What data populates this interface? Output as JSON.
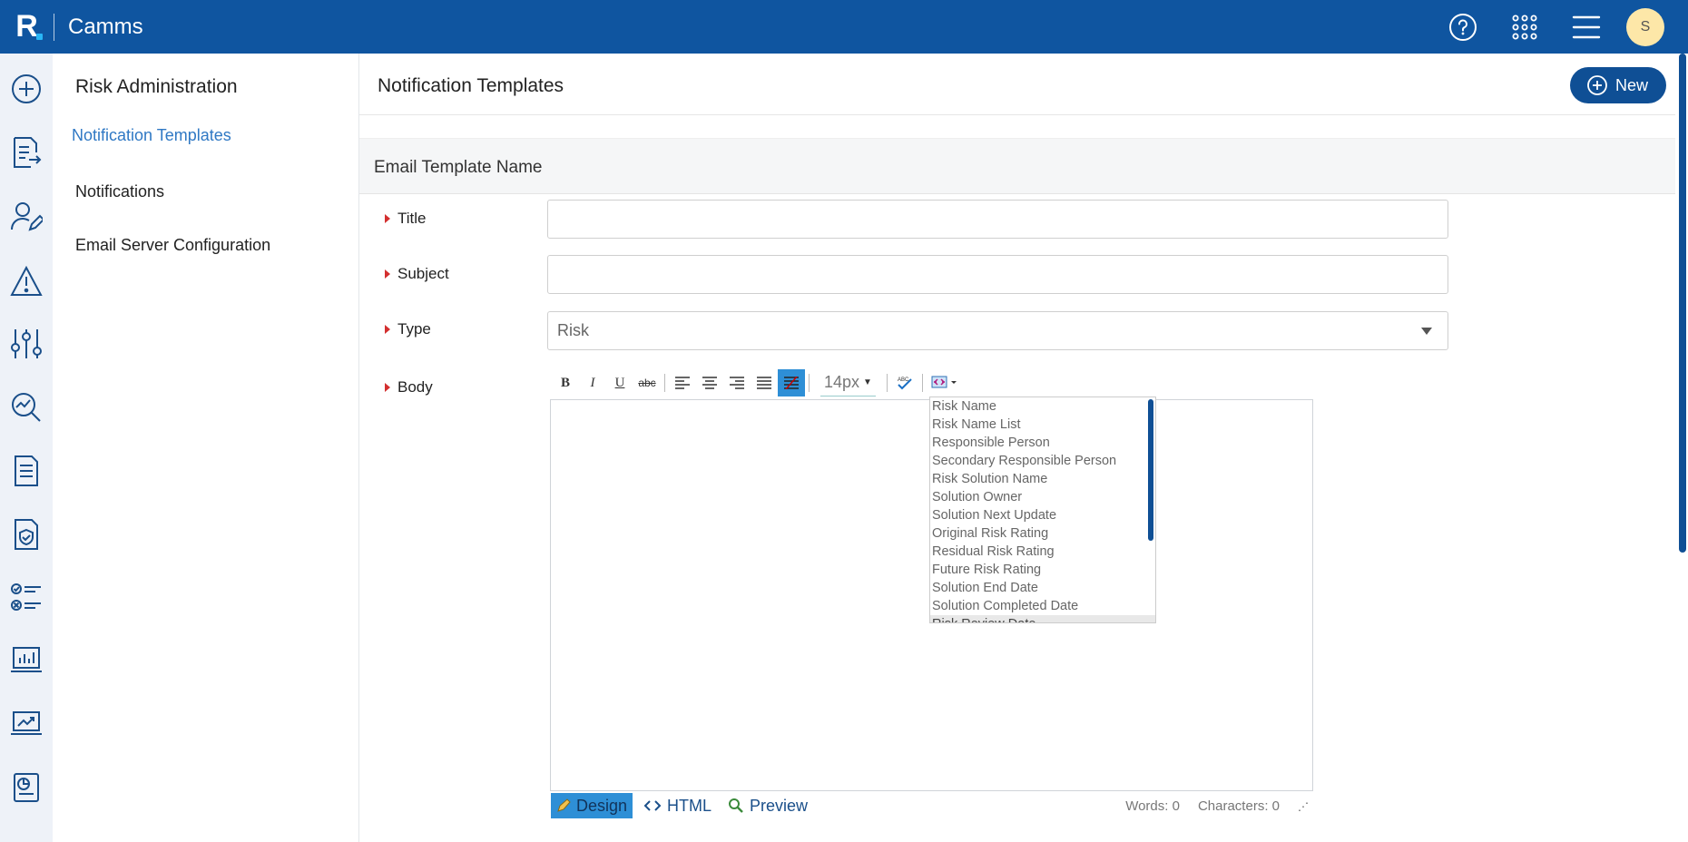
{
  "app": {
    "name": "Camms",
    "logo_letter": "R",
    "avatar_initial": "S"
  },
  "subnav": {
    "title": "Risk Administration",
    "items": [
      {
        "label": "Notification Templates"
      },
      {
        "label": "Notifications"
      },
      {
        "label": "Email Server Configuration"
      }
    ]
  },
  "page": {
    "title": "Notification Templates",
    "new_label": "New"
  },
  "form": {
    "section_title": "Email Template Name",
    "title_label": "Title",
    "subject_label": "Subject",
    "type_label": "Type",
    "type_value": "Risk",
    "body_label": "Body"
  },
  "editor": {
    "font_size": "14px",
    "placeholder_items": [
      "Risk Name",
      "Risk Name List",
      "Responsible Person",
      "Secondary Responsible Person",
      "Risk Solution Name",
      "Solution Owner",
      "Solution Next Update",
      "Original Risk Rating",
      "Residual Risk Rating",
      "Future Risk Rating",
      "Solution End Date",
      "Solution Completed Date",
      "Risk Review Date"
    ],
    "modes": {
      "design": "Design",
      "html": "HTML",
      "preview": "Preview"
    },
    "words_label": "Words: 0",
    "chars_label": "Characters: 0"
  },
  "colors": {
    "brand": "#0f55a0",
    "accent": "#2f78c4",
    "required": "#d32f2f"
  }
}
